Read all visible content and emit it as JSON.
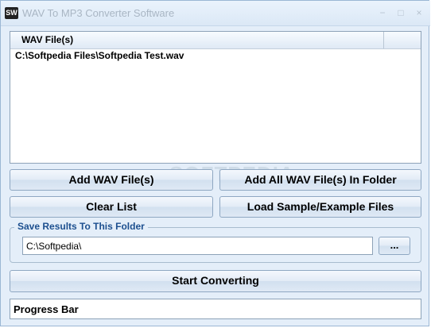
{
  "window": {
    "title": "WAV To MP3 Converter Software",
    "icon_label": "SW",
    "controls": {
      "minimize": "−",
      "maximize": "□",
      "close": "×"
    }
  },
  "file_list": {
    "column_header": "WAV File(s)",
    "items": [
      "C:\\Softpedia Files\\Softpedia Test.wav"
    ]
  },
  "buttons": {
    "add_files": "Add WAV File(s)",
    "add_folder": "Add All WAV File(s) In Folder",
    "clear_list": "Clear List",
    "load_samples": "Load Sample/Example Files",
    "browse": "...",
    "start": "Start Converting"
  },
  "save_folder": {
    "legend": "Save Results To This Folder",
    "value": "C:\\Softpedia\\"
  },
  "progress": {
    "label": "Progress Bar",
    "fraction": 0,
    "fill_color": "#6fbf5e"
  },
  "watermark": "SOFTPEDIA"
}
